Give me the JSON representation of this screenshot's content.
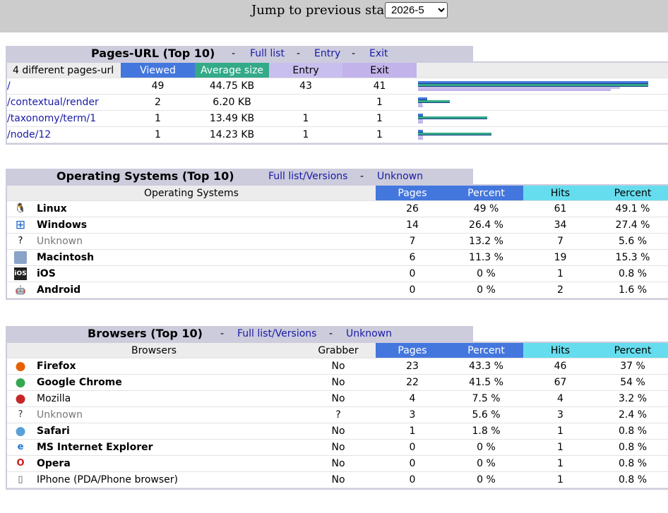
{
  "jump": {
    "label": "Jump to previous stats:",
    "selected": "2026-5"
  },
  "pages": {
    "title": "Pages-URL (Top 10)",
    "links": [
      "Full list",
      "Entry",
      "Exit"
    ],
    "headers": [
      "4 different pages-url",
      "Viewed",
      "Average size",
      "Entry",
      "Exit"
    ],
    "rows": [
      {
        "url": "/",
        "viewed": "49",
        "size": "44.75 KB",
        "entry": "43",
        "exit": "41",
        "bars": {
          "viewed": 49,
          "size": 44.75,
          "entry": 43,
          "exit": 41
        }
      },
      {
        "url": "/contextual/render",
        "viewed": "2",
        "size": "6.20 KB",
        "entry": "",
        "exit": "1",
        "bars": {
          "viewed": 2,
          "size": 6.2,
          "entry": 0,
          "exit": 1
        }
      },
      {
        "url": "/taxonomy/term/1",
        "viewed": "1",
        "size": "13.49 KB",
        "entry": "1",
        "exit": "1",
        "bars": {
          "viewed": 1,
          "size": 13.49,
          "entry": 1,
          "exit": 1
        }
      },
      {
        "url": "/node/12",
        "viewed": "1",
        "size": "14.23 KB",
        "entry": "1",
        "exit": "1",
        "bars": {
          "viewed": 1,
          "size": 14.23,
          "entry": 1,
          "exit": 1
        }
      }
    ],
    "bar_colors": {
      "viewed": "#4477dd",
      "size": "#33aa88",
      "entry": "#c9bfee",
      "exit": "#c2b3ea"
    }
  },
  "os": {
    "title": "Operating Systems (Top 10)",
    "links": [
      "Full list/Versions",
      "Unknown"
    ],
    "headers": [
      "Operating Systems",
      "Pages",
      "Percent",
      "Hits",
      "Percent"
    ],
    "rows": [
      {
        "icon": "linux-icon",
        "glyph": "🐧",
        "name": "Linux",
        "bold": true,
        "pages": "26",
        "ppct": "49 %",
        "hits": "61",
        "hpct": "49.1 %"
      },
      {
        "icon": "windows-icon",
        "glyph": "⊞",
        "name": "Windows",
        "bold": true,
        "pages": "14",
        "ppct": "26.4 %",
        "hits": "34",
        "hpct": "27.4 %"
      },
      {
        "icon": "unknown-icon",
        "glyph": "?",
        "name": "Unknown",
        "bold": false,
        "grey": true,
        "pages": "7",
        "ppct": "13.2 %",
        "hits": "7",
        "hpct": "5.6 %"
      },
      {
        "icon": "macintosh-icon",
        "glyph": "",
        "name": "Macintosh",
        "bold": true,
        "pages": "6",
        "ppct": "11.3 %",
        "hits": "19",
        "hpct": "15.3 %"
      },
      {
        "icon": "ios-icon",
        "glyph": "iOS",
        "name": "iOS",
        "bold": true,
        "pages": "0",
        "ppct": "0 %",
        "hits": "1",
        "hpct": "0.8 %"
      },
      {
        "icon": "android-icon",
        "glyph": "🤖",
        "name": "Android",
        "bold": true,
        "pages": "0",
        "ppct": "0 %",
        "hits": "2",
        "hpct": "1.6 %"
      }
    ]
  },
  "browsers": {
    "title": "Browsers (Top 10)",
    "links": [
      "Full list/Versions",
      "Unknown"
    ],
    "headers": [
      "Browsers",
      "Grabber",
      "Pages",
      "Percent",
      "Hits",
      "Percent"
    ],
    "rows": [
      {
        "icon": "firefox-icon",
        "glyph": "●",
        "color": "#e66000",
        "name": "Firefox",
        "bold": true,
        "grabber": "No",
        "pages": "23",
        "ppct": "43.3 %",
        "hits": "46",
        "hpct": "37 %"
      },
      {
        "icon": "chrome-icon",
        "glyph": "●",
        "color": "#34a853",
        "name": "Google Chrome",
        "bold": true,
        "grabber": "No",
        "pages": "22",
        "ppct": "41.5 %",
        "hits": "67",
        "hpct": "54 %"
      },
      {
        "icon": "mozilla-icon",
        "glyph": "●",
        "color": "#c62828",
        "name": "Mozilla",
        "bold": false,
        "grabber": "No",
        "pages": "4",
        "ppct": "7.5 %",
        "hits": "4",
        "hpct": "3.2 %"
      },
      {
        "icon": "unknown-icon",
        "glyph": "?",
        "color": "#333333",
        "name": "Unknown",
        "bold": false,
        "grey": true,
        "grabber": "?",
        "pages": "3",
        "ppct": "5.6 %",
        "hits": "3",
        "hpct": "2.4 %"
      },
      {
        "icon": "safari-icon",
        "glyph": "●",
        "color": "#5aa0d8",
        "name": "Safari",
        "bold": true,
        "grabber": "No",
        "pages": "1",
        "ppct": "1.8 %",
        "hits": "1",
        "hpct": "0.8 %"
      },
      {
        "icon": "ie-icon",
        "glyph": "e",
        "color": "#1e73d8",
        "name": "MS Internet Explorer",
        "bold": true,
        "grabber": "No",
        "pages": "0",
        "ppct": "0 %",
        "hits": "1",
        "hpct": "0.8 %"
      },
      {
        "icon": "opera-icon",
        "glyph": "O",
        "color": "#cc1b1b",
        "name": "Opera",
        "bold": true,
        "grabber": "No",
        "pages": "0",
        "ppct": "0 %",
        "hits": "1",
        "hpct": "0.8 %"
      },
      {
        "icon": "iphone-icon",
        "glyph": "▯",
        "color": "#555555",
        "name": "IPhone (PDA/Phone browser)",
        "bold": false,
        "grabber": "No",
        "pages": "0",
        "ppct": "0 %",
        "hits": "1",
        "hpct": "0.8 %"
      }
    ]
  }
}
